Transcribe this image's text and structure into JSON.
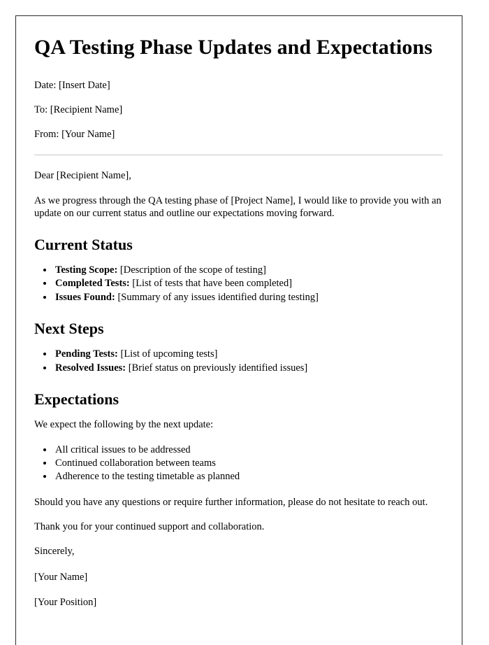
{
  "document": {
    "title": "QA Testing Phase Updates and Expectations",
    "meta": [
      {
        "label": "Date:",
        "value": "[Insert Date]",
        "text": "Date: [Insert Date]"
      },
      {
        "label": "To:",
        "value": "[Recipient Name]",
        "text": "To: [Recipient Name]"
      },
      {
        "label": "From:",
        "value": "[Your Name]",
        "text": "From: [Your Name]"
      }
    ],
    "salutation": "Dear [Recipient Name],",
    "intro_paragraph": "As we progress through the QA testing phase of [Project Name], I would like to provide you with an update on our current status and outline our expectations moving forward.",
    "sections": [
      {
        "heading": "Current Status",
        "items": [
          {
            "lead": "Testing Scope:",
            "rest": " [Description of the scope of testing]"
          },
          {
            "lead": "Completed Tests:",
            "rest": " [List of tests that have been completed]"
          },
          {
            "lead": "Issues Found:",
            "rest": " [Summary of any issues identified during testing]"
          }
        ]
      },
      {
        "heading": "Next Steps",
        "items": [
          {
            "lead": "Pending Tests:",
            "rest": " [List of upcoming tests]"
          },
          {
            "lead": "Resolved Issues:",
            "rest": " [Brief status on previously identified issues]"
          }
        ]
      },
      {
        "heading": "Expectations",
        "intro": "We expect the following by the next update:",
        "items": [
          {
            "lead": "",
            "rest": "All critical issues to be addressed"
          },
          {
            "lead": "",
            "rest": "Continued collaboration between teams"
          },
          {
            "lead": "",
            "rest": "Adherence to the testing timetable as planned"
          }
        ]
      }
    ],
    "closing_paragraph": "Should you have any questions or require further information, please do not hesitate to reach out.",
    "thanks_paragraph": "Thank you for your continued support and collaboration.",
    "signoff": "Sincerely,",
    "signature_name": "[Your Name]",
    "signature_position": "[Your Position]"
  },
  "colors": {
    "page_border": "#2b2b2b",
    "divider": "#c9c9c9",
    "text": "#000000",
    "background": "#ffffff"
  }
}
